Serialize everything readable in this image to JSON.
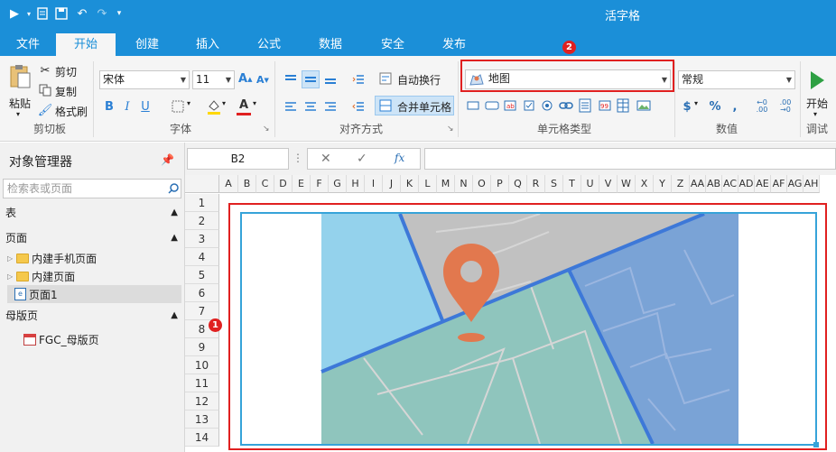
{
  "app": {
    "title": "活字格"
  },
  "ribbon_tabs": [
    "文件",
    "开始",
    "创建",
    "插入",
    "公式",
    "数据",
    "安全",
    "发布"
  ],
  "active_tab": "开始",
  "clipboard": {
    "paste": "粘贴",
    "cut": "剪切",
    "copy": "复制",
    "format_painter": "格式刷",
    "group": "剪切板"
  },
  "font": {
    "family": "宋体",
    "size": "11",
    "group": "字体"
  },
  "align": {
    "wrap": "自动换行",
    "merge": "合并单元格",
    "group": "对齐方式"
  },
  "celltype": {
    "selected": "地图",
    "group": "单元格类型"
  },
  "number": {
    "format": "常规",
    "group": "数值"
  },
  "debug": {
    "start": "开始",
    "group": "调试"
  },
  "object_manager": {
    "title": "对象管理器",
    "search_placeholder": "检索表或页面",
    "sections": {
      "tables": "表",
      "pages": "页面",
      "master": "母版页"
    },
    "pages": [
      "内建手机页面",
      "内建页面",
      "页面1"
    ],
    "master_pages": [
      "FGC_母版页"
    ]
  },
  "formula": {
    "cell_ref": "B2"
  },
  "columns": [
    "A",
    "B",
    "C",
    "D",
    "E",
    "F",
    "G",
    "H",
    "I",
    "J",
    "K",
    "L",
    "M",
    "N",
    "O",
    "P",
    "Q",
    "R",
    "S",
    "T",
    "U",
    "V",
    "W",
    "X",
    "Y",
    "Z",
    "AA",
    "AB",
    "AC",
    "AD",
    "AE",
    "AF",
    "AG",
    "AH"
  ],
  "rows": [
    "1",
    "2",
    "3",
    "4",
    "5",
    "6",
    "7",
    "8",
    "9",
    "10",
    "11",
    "12",
    "13",
    "14"
  ],
  "badges": [
    "1",
    "2"
  ],
  "colors": {
    "brand": "#1b8fd8",
    "highlight": "#e02020",
    "map_pin": "#e2784e"
  }
}
